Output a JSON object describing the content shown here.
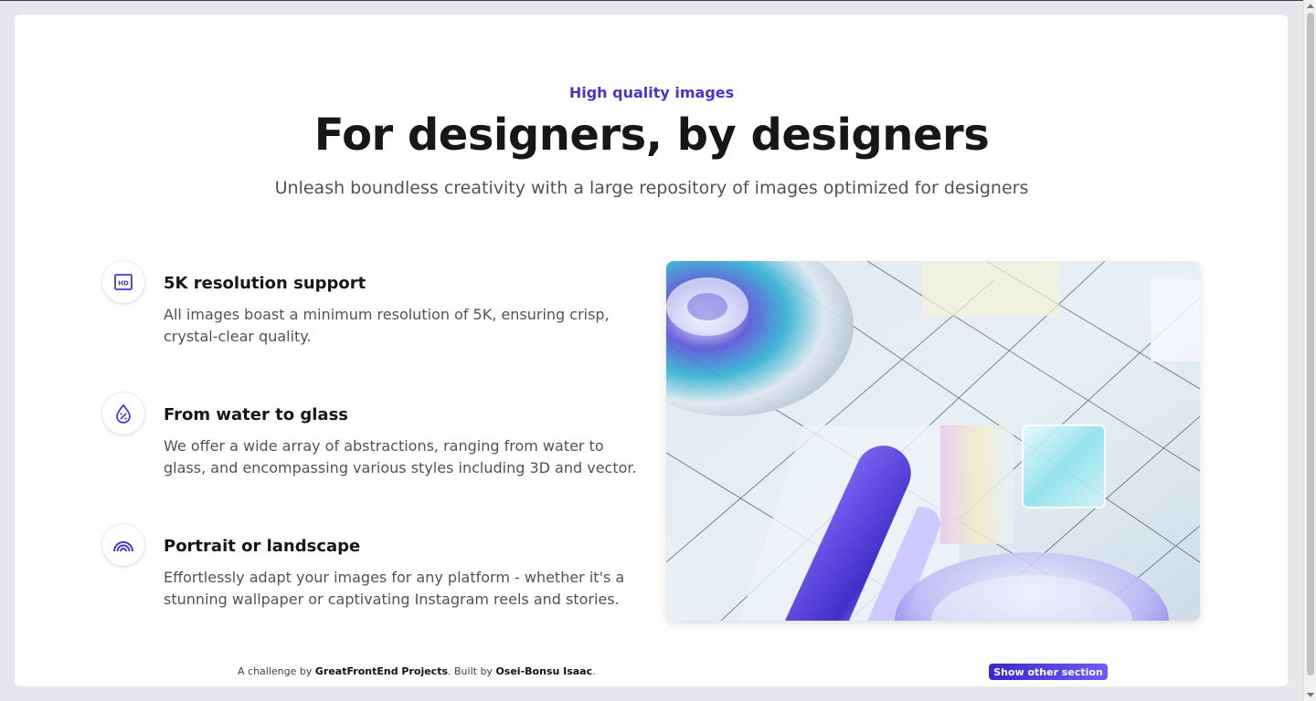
{
  "header": {
    "eyebrow": "High quality images",
    "title": "For designers, by designers",
    "subtitle": "Unleash boundless creativity with a large repository of images optimized for designers"
  },
  "features": [
    {
      "icon": "hd-icon",
      "title": "5K resolution support",
      "description": "All images boast a minimum resolution of 5K, ensuring crisp, crystal-clear quality."
    },
    {
      "icon": "drop-percent-icon",
      "title": "From water to glass",
      "description": "We offer a wide array of abstractions, ranging from water to glass, and encompassing various styles including 3D and vector."
    },
    {
      "icon": "rainbow-icon",
      "title": "Portrait or landscape",
      "description": "Effortlessly adapt your images for any platform - whether it's a stunning wallpaper or captivating Instagram reels and stories."
    }
  ],
  "footer": {
    "prefix": "A challenge by ",
    "challenge_author": "GreatFrontEnd Projects",
    "middle": ". Built by ",
    "builder": "Osei-Bonsu Isaac",
    "suffix": ".",
    "button_label": "Show other section"
  },
  "colors": {
    "accent": "#4338ca",
    "heading": "#171717",
    "body": "#525252"
  }
}
